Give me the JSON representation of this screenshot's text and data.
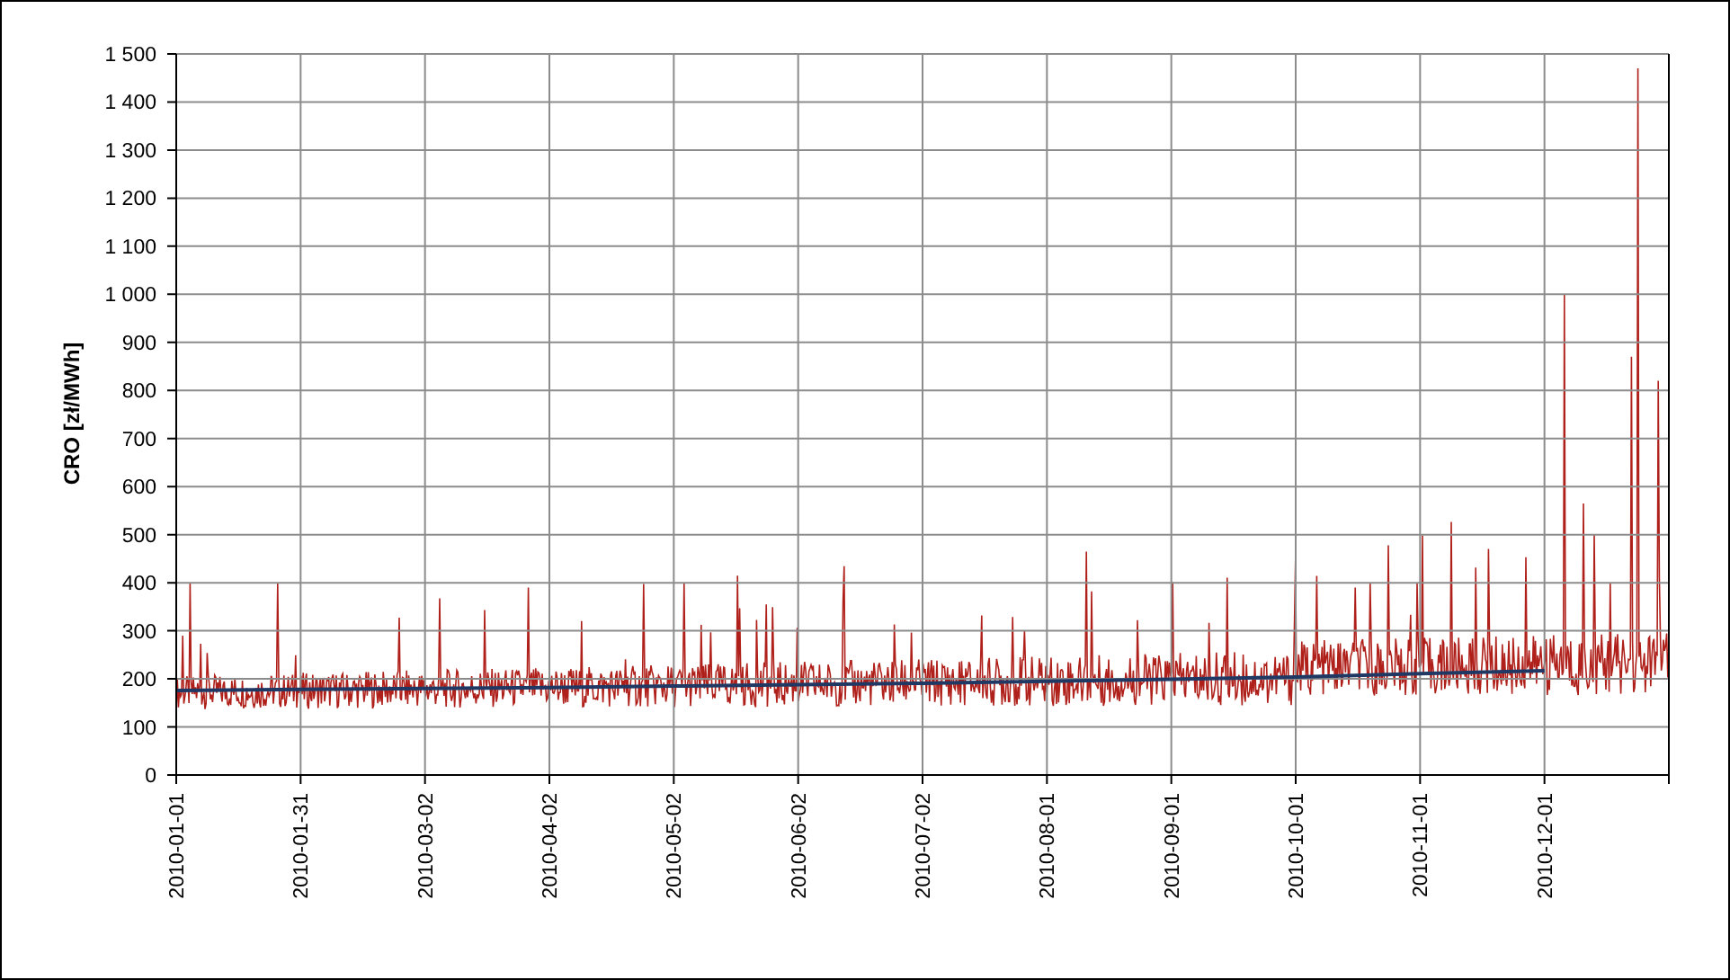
{
  "chart": {
    "chart_data": {
      "type": "line",
      "ylabel": "CRO [zł/MWh]",
      "categories": [
        "2010-01-01",
        "2010-01-31",
        "2010-03-02",
        "2010-04-02",
        "2010-05-02",
        "2010-06-02",
        "2010-07-02",
        "2010-08-01",
        "2010-09-01",
        "2010-10-01",
        "2010-11-01",
        "2010-12-01"
      ],
      "grid": true,
      "series": [
        {
          "color": "#1f3864",
          "values": [
            176,
            178,
            180,
            182,
            185,
            188,
            191,
            195,
            199,
            204,
            211,
            217
          ]
        }
      ],
      "ylim": [
        0,
        1500
      ],
      "yticks": [
        0,
        100,
        200,
        300,
        400,
        500,
        600,
        700,
        800,
        900,
        {
          "value": 1000,
          "label": "1 000"
        },
        {
          "value": 1100,
          "label": "1 100"
        },
        {
          "value": 1200,
          "label": "1 200"
        },
        {
          "value": 1300,
          "label": "1 300"
        },
        {
          "value": 1400,
          "label": "1 400"
        },
        {
          "value": 1500,
          "label": "1 500"
        }
      ]
    }
  }
}
